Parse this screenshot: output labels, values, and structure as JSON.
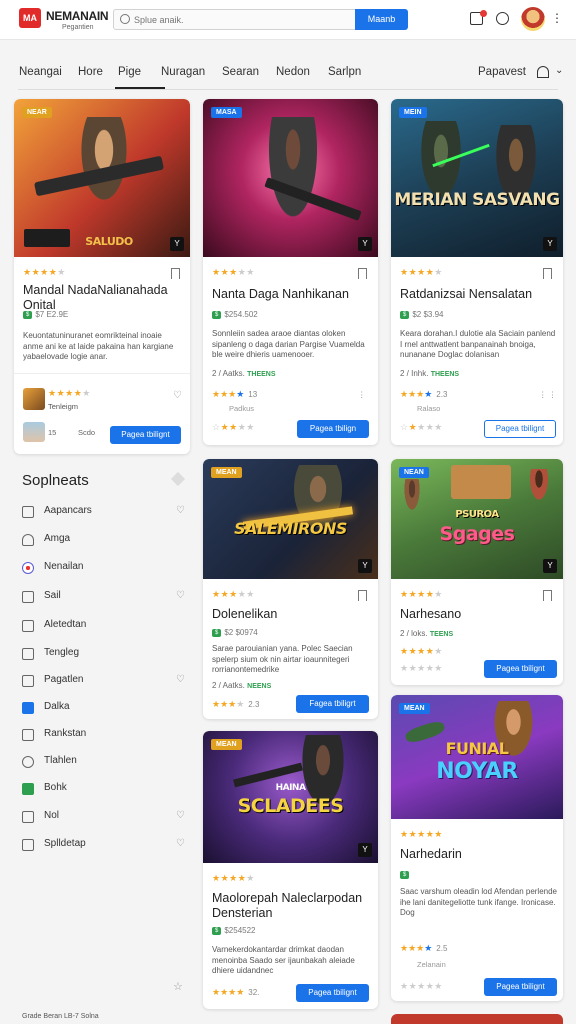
{
  "header": {
    "logo_text": "MA",
    "brand": "NEMANAIN",
    "brand_sub": "Pegantien",
    "search_placeholder": "Splue anaik.",
    "search_button": "Maanb"
  },
  "nav": {
    "items": [
      "Neangai",
      "Hore",
      "Pige",
      "Nuragan",
      "Searan",
      "Nedon",
      "Sarlpn"
    ],
    "active_index": 2,
    "right_item": "Papavest"
  },
  "featured_card": {
    "badge": "NEAR",
    "thumb_text": "SALUDO",
    "title": "Mandal NadaNalianahada Onital",
    "price": "$7 E2.9E",
    "desc": "Keuontatuninuranet eomrikteinal inoaie anme ani ke at laide pakaina han kargiane yabaelovade logie anar.",
    "seller_name": "Tenleigm",
    "foot_num": "15",
    "foot_label": "Scdo",
    "button": "Pagea tbilignt"
  },
  "cards": [
    {
      "badge": "MASA",
      "title": "Nanta Daga Nanhikanan",
      "price": "$254.502",
      "desc": "Sonnleiin sadea araoe diantas oloken sipanleng o daga darian Pargise Vuamelda ble weire dhieris uamenooer.",
      "meta_left": "2 / Aatks.",
      "meta_tag": "THEENS",
      "rating_num": "13",
      "sub": "Padkus",
      "button": "Pagea tbilign",
      "outline": false
    },
    {
      "badge": "MEIN",
      "thumb_text": "MERIAN SASVANG",
      "title": "Ratdanizsai Nensalatan",
      "price": "$2 $3.94",
      "desc": "Keara dorahan.I dulotie ala Saciain panlend I rnel anttwatlent banpanainah bnoiga, nunanane Doglac dolanisan",
      "meta_left": "2 / Inhk.",
      "meta_tag": "THEENS",
      "rating_num": "2.3",
      "sub": "Ralaso",
      "button": "Pagea tbilignt",
      "outline": true
    },
    {
      "badge": "MEAN",
      "thumb_text": "SALEMIRONS",
      "title": "Dolenelikan",
      "price": "$2 $0974",
      "desc": "Sarae parouianian yana. Polec Saecian spelerp sium ok nin airtar ioaunnitegeri rorrianontemedrike",
      "meta_left": "2 / Aatks.",
      "meta_tag": "NEENS",
      "rating_num": "2.3",
      "sub": "",
      "button": "Fagea tbiligrt",
      "outline": false
    },
    {
      "badge": "NEAN",
      "thumb_text": "Sgages",
      "thumb_sub": "PSUROA",
      "title": "Narhesano",
      "price": "",
      "desc": "",
      "meta_left": "2 / loks.",
      "meta_tag": "TEENS",
      "rating_num": "",
      "sub": "",
      "button": "Pagea tbilignt",
      "outline": false
    },
    {
      "badge": "MEAN",
      "thumb_text": "SCLADEES",
      "thumb_sub": "HAINA",
      "title": "Maolorepah Naleclarpodan Densterian",
      "price": "$254522",
      "desc": "Varnekerdokantardar drimkat daodan menoinba Saado ser ijaunbakah aleiade dhiere uidandnec",
      "meta_left": "",
      "meta_tag": "",
      "rating_num": "32.",
      "sub": "",
      "button": "Pagea tbilignt",
      "outline": false
    },
    {
      "badge": "MEAN",
      "thumb_text": "NOYAR",
      "thumb_sub": "FUNIAL",
      "title": "Narhedarin",
      "price": "",
      "desc": "Saac varshum oleadin lod Afendan perlende ihe lani danitegeliotte tunk ifange. Ironicase. Dog",
      "meta_left": "",
      "meta_tag": "",
      "rating_num": "2.5",
      "sub": "Zelanain",
      "button": "Pagea tbilignt",
      "outline": false
    }
  ],
  "sidebar": {
    "title": "Soplneats",
    "items": [
      {
        "label": "Aapancars",
        "heart": true
      },
      {
        "label": "Amga",
        "heart": false
      },
      {
        "label": "Nenailan",
        "heart": false
      },
      {
        "label": "Sail",
        "heart": true
      },
      {
        "label": "Aletedtan",
        "heart": false
      },
      {
        "label": "Tengleg",
        "heart": false
      },
      {
        "label": "Pagatlen",
        "heart": true
      },
      {
        "label": "Dalka",
        "heart": false
      },
      {
        "label": "Rankstan",
        "heart": false
      },
      {
        "label": "Tlahlen",
        "heart": false
      },
      {
        "label": "Bohk",
        "heart": false
      },
      {
        "label": "Nol",
        "heart": true
      },
      {
        "label": "Splldetap",
        "heart": true
      }
    ]
  },
  "footer": {
    "text": "Grade Beran LB-7 Solna"
  },
  "colors": {
    "accent": "#1a73e8",
    "brand": "#e12a2a",
    "star": "#f5a623",
    "tag": "#2e9e4f"
  }
}
